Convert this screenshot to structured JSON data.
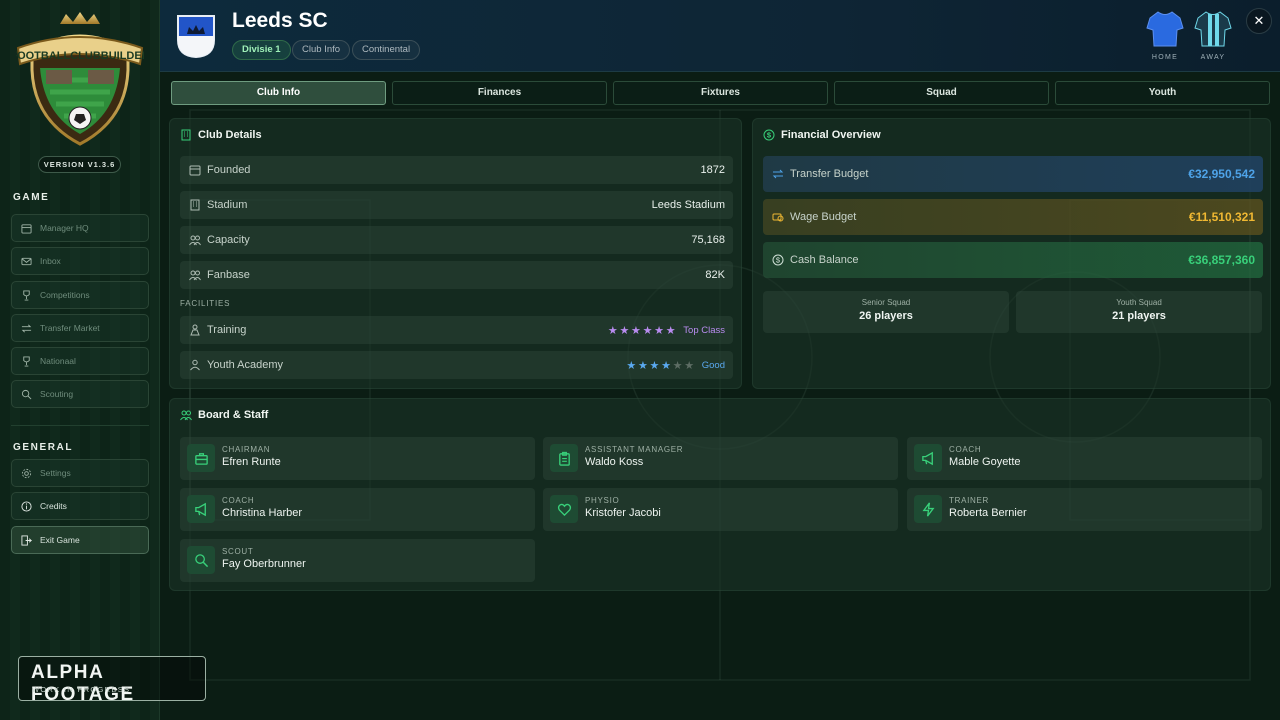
{
  "app": {
    "version": "VERSION V1.3.6"
  },
  "alpha": {
    "title": "ALPHA FOOTAGE",
    "subtitle": "WORK IN PROGRESS"
  },
  "sidebar": {
    "game_title": "GAME",
    "game_items": [
      {
        "label": "Manager HQ",
        "icon": "calendar-icon"
      },
      {
        "label": "Inbox",
        "icon": "mail-icon"
      },
      {
        "label": "Competitions",
        "icon": "trophy-icon"
      },
      {
        "label": "Transfer Market",
        "icon": "transfer-icon"
      },
      {
        "label": "Nationaal",
        "icon": "trophy-icon"
      },
      {
        "label": "Scouting",
        "icon": "search-icon"
      }
    ],
    "general_title": "GENERAL",
    "general_items": [
      {
        "label": "Settings",
        "icon": "gear-icon"
      },
      {
        "label": "Credits",
        "icon": "info-icon"
      },
      {
        "label": "Exit Game",
        "icon": "exit-icon"
      }
    ]
  },
  "header": {
    "club_name": "Leeds SC",
    "pills": [
      "Divisie 1",
      "Club Info",
      "Continental"
    ],
    "kits": {
      "home": "HOME",
      "away": "AWAY"
    },
    "close": "✕"
  },
  "tabs": [
    "Club Info",
    "Finances",
    "Fixtures",
    "Squad",
    "Youth"
  ],
  "club_details": {
    "title": "Club Details",
    "rows": [
      {
        "label": "Founded",
        "value": "1872",
        "icon": "calendar-icon"
      },
      {
        "label": "Stadium",
        "value": "Leeds Stadium",
        "icon": "building-icon"
      },
      {
        "label": "Capacity",
        "value": "75,168",
        "icon": "people-icon"
      },
      {
        "label": "Fanbase",
        "value": "82K",
        "icon": "people-icon"
      }
    ],
    "facilities_label": "FACILITIES",
    "facilities": [
      {
        "label": "Training",
        "stars": 6,
        "max": 6,
        "rating": "Top Class",
        "color": "#b98cf0"
      },
      {
        "label": "Youth Academy",
        "stars": 4,
        "max": 6,
        "rating": "Good",
        "color": "#5aa9f0"
      }
    ]
  },
  "financial": {
    "title": "Financial Overview",
    "rows": [
      {
        "label": "Transfer Budget",
        "value": "€32,950,542",
        "color": "#4ea3e8"
      },
      {
        "label": "Wage Budget",
        "value": "€11,510,321",
        "color": "#f0b832"
      },
      {
        "label": "Cash Balance",
        "value": "€36,857,360",
        "color": "#38d07a"
      }
    ],
    "senior_label": "Senior Squad",
    "senior_value": "26 players",
    "youth_label": "Youth Squad",
    "youth_value": "21 players"
  },
  "board": {
    "title": "Board & Staff",
    "members": [
      {
        "role": "CHAIRMAN",
        "name": "Efren Runte",
        "icon": "briefcase-icon"
      },
      {
        "role": "ASSISTANT MANAGER",
        "name": "Waldo Koss",
        "icon": "clipboard-icon"
      },
      {
        "role": "COACH",
        "name": "Mable Goyette",
        "icon": "megaphone-icon"
      },
      {
        "role": "COACH",
        "name": "Christina Harber",
        "icon": "megaphone-icon"
      },
      {
        "role": "PHYSIO",
        "name": "Kristofer Jacobi",
        "icon": "heart-icon"
      },
      {
        "role": "TRAINER",
        "name": "Roberta Bernier",
        "icon": "lightning-icon"
      },
      {
        "role": "SCOUT",
        "name": "Fay Oberbrunner",
        "icon": "search-icon"
      }
    ]
  },
  "colors": {
    "accent": "#38d07a",
    "transfer": "#4ea3e8",
    "wage": "#f0b832",
    "cash": "#38d07a"
  }
}
